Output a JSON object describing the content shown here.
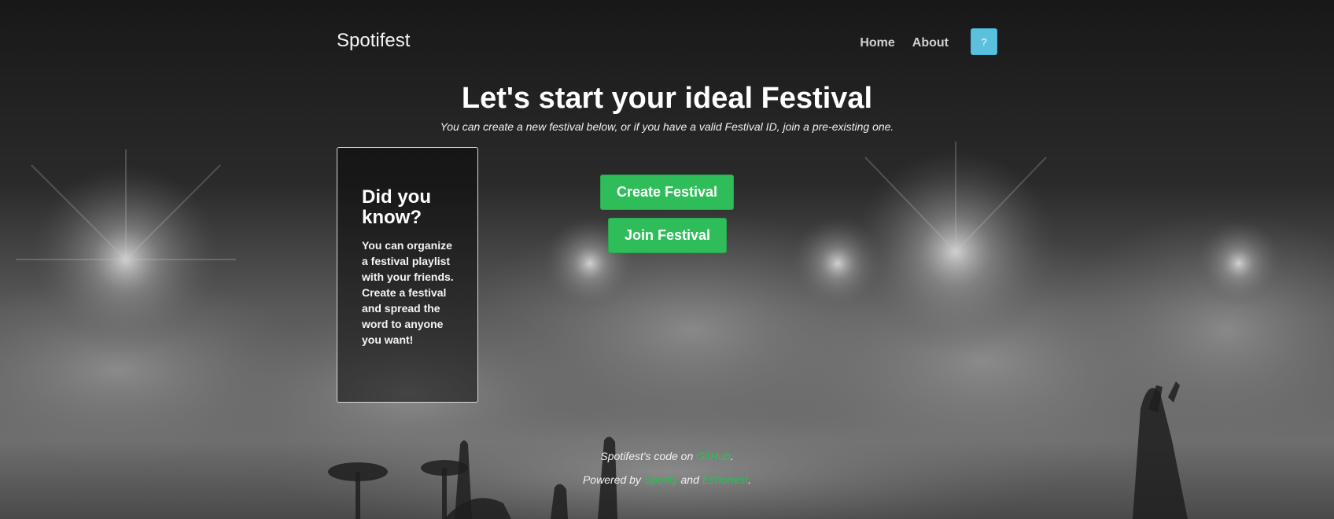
{
  "nav": {
    "brand": "Spotifest",
    "links": [
      "Home",
      "About"
    ],
    "help_label": "?"
  },
  "hero": {
    "title": "Let's start your ideal Festival",
    "subtitle": "You can create a new festival below, or if you have a valid Festival ID, join a pre-existing one."
  },
  "tip": {
    "title": "Did you know?",
    "body": "You can organize a festival playlist with your friends. Create a festival and spread the word to anyone you want!"
  },
  "actions": {
    "create_label": "Create Festival",
    "join_label": "Join Festival"
  },
  "footer": {
    "code_prefix": "Spotifest's code on ",
    "github_link": "GitHub",
    "code_suffix": ".",
    "powered_prefix": "Powered by ",
    "spotify_link": "Spotify",
    "and_text": " and ",
    "echonest_link": "Echonest",
    "powered_suffix": "."
  },
  "colors": {
    "accent_green": "#2fbd59",
    "help_blue": "#5bc0de",
    "background": "#1b1b1b"
  }
}
